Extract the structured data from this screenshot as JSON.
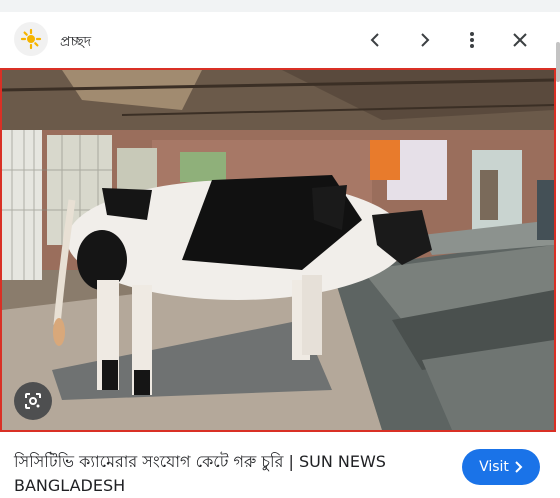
{
  "header": {
    "title": "প্রচ্ছদ",
    "logo_icon": "sun-logo-icon",
    "prev_icon": "chevron-left-icon",
    "next_icon": "chevron-right-icon",
    "more_icon": "more-vert-icon",
    "close_icon": "close-icon"
  },
  "image": {
    "lens_icon": "google-lens-icon",
    "border_color": "#d93025"
  },
  "caption": {
    "text": "সিসিটিভি ক্যামেরার সংযোগ কেটে গরু চুরি | SUN NEWS BANGLADESH"
  },
  "visit_button": {
    "label": "Visit",
    "icon": "chevron-right-icon",
    "color": "#1a73e8"
  }
}
